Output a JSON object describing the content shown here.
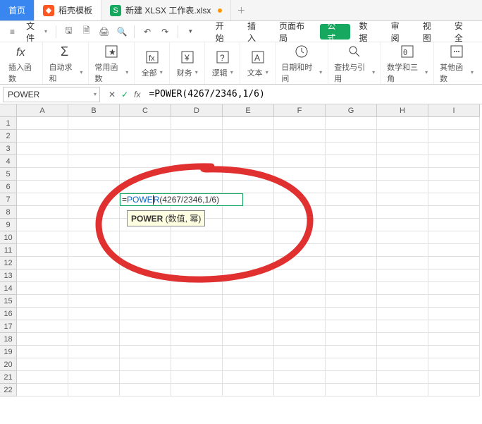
{
  "tabs": {
    "home": "首页",
    "mod": "稻壳模板",
    "file": "新建 XLSX 工作表.xlsx"
  },
  "menubar": {
    "file": "文件"
  },
  "ribbonTabs": {
    "start": "开始",
    "insert": "插入",
    "layout": "页面布局",
    "formula": "公式",
    "data": "数据",
    "review": "审阅",
    "view": "视图",
    "security": "安全"
  },
  "ribbon": {
    "insertfn": "插入函数",
    "autosum": "自动求和",
    "common": "常用函数",
    "all": "全部",
    "finance": "财务",
    "logic": "逻辑",
    "text": "文本",
    "datetime": "日期和时间",
    "lookup": "查找与引用",
    "math": "数学和三角",
    "other": "其他函数"
  },
  "namebox": "POWER",
  "formula": "=POWER(4267/2346,1/6)",
  "cellFormula": {
    "prefix": "=",
    "fn": "POWE",
    "cursor": "R",
    "rest": "(4267/2346,1/6)"
  },
  "hint": {
    "fn": "POWER",
    "args": " (数值, 幂)"
  },
  "cols": [
    "A",
    "B",
    "C",
    "D",
    "E",
    "F",
    "G",
    "H",
    "I"
  ],
  "rows": [
    "1",
    "2",
    "3",
    "4",
    "5",
    "6",
    "7",
    "8",
    "9",
    "10",
    "11",
    "12",
    "13",
    "14",
    "15",
    "16",
    "17",
    "18",
    "19",
    "20",
    "21",
    "22"
  ]
}
